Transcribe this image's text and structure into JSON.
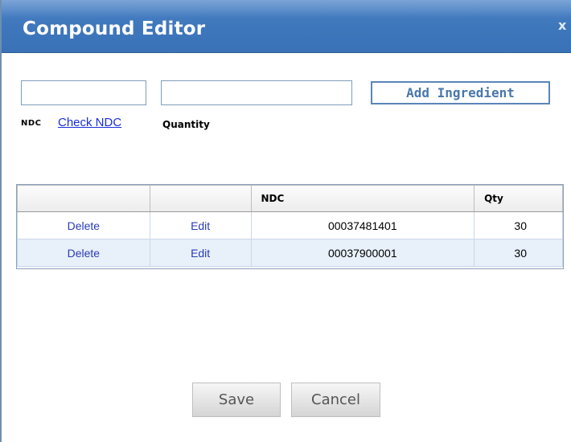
{
  "dialog": {
    "title": "Compound Editor",
    "close_label": "x"
  },
  "form": {
    "ndc_value": "",
    "quantity_value": "",
    "add_button_label": "Add Ingredient",
    "ndc_label": "NDC",
    "check_ndc_link": "Check NDC",
    "quantity_label": "Quantity"
  },
  "table": {
    "headers": [
      "",
      "",
      "NDC",
      "Qty"
    ],
    "rows": [
      {
        "delete": "Delete",
        "edit": "Edit",
        "ndc": "00037481401",
        "qty": "30"
      },
      {
        "delete": "Delete",
        "edit": "Edit",
        "ndc": "00037900001",
        "qty": "30"
      }
    ]
  },
  "footer": {
    "save_label": "Save",
    "cancel_label": "Cancel"
  },
  "colors": {
    "titlebar": "#3f77bc",
    "link": "#1a2fd6",
    "alt_row": "#e8f0fa"
  }
}
